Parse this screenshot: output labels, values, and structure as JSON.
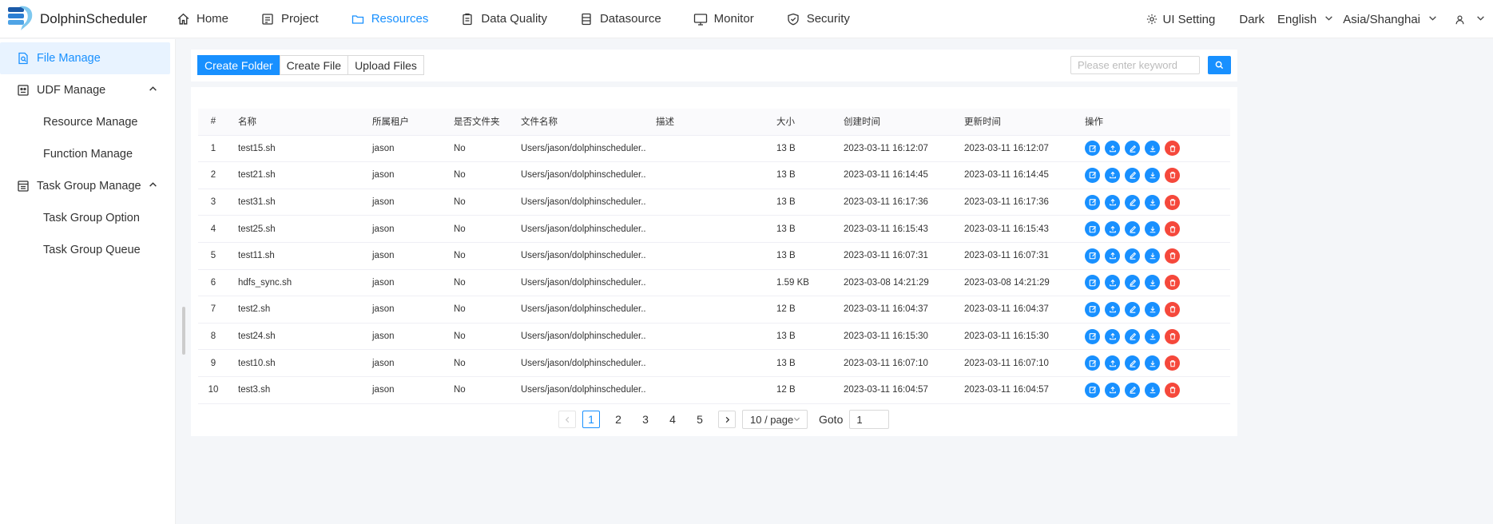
{
  "app": {
    "title": "DolphinScheduler"
  },
  "nav": [
    {
      "label": "Home",
      "icon": "home-icon"
    },
    {
      "label": "Project",
      "icon": "project-icon"
    },
    {
      "label": "Resources",
      "icon": "folder-icon",
      "active": true
    },
    {
      "label": "Data Quality",
      "icon": "clipboard-icon"
    },
    {
      "label": "Datasource",
      "icon": "datasource-icon"
    },
    {
      "label": "Monitor",
      "icon": "monitor-icon"
    },
    {
      "label": "Security",
      "icon": "shield-icon"
    }
  ],
  "header_right": {
    "ui_setting": "UI Setting",
    "theme": "Dark",
    "language": "English",
    "timezone": "Asia/Shanghai"
  },
  "sidebar": {
    "file_manage": "File Manage",
    "udf_manage": "UDF Manage",
    "resource_manage": "Resource Manage",
    "function_manage": "Function Manage",
    "task_group_manage": "Task Group Manage",
    "task_group_option": "Task Group Option",
    "task_group_queue": "Task Group Queue"
  },
  "toolbar": {
    "create_folder": "Create Folder",
    "create_file": "Create File",
    "upload_files": "Upload Files",
    "search_placeholder": "Please enter keyword"
  },
  "table": {
    "headers": [
      "#",
      "名称",
      "所属租户",
      "是否文件夹",
      "文件名称",
      "描述",
      "大小",
      "创建时间",
      "更新时间",
      "操作"
    ],
    "rows": [
      [
        "1",
        "test15.sh",
        "jason",
        "No",
        "Users/jason/dolphinscheduler...",
        "",
        "13 B",
        "2023-03-11 16:12:07",
        "2023-03-11 16:12:07"
      ],
      [
        "2",
        "test21.sh",
        "jason",
        "No",
        "Users/jason/dolphinscheduler...",
        "",
        "13 B",
        "2023-03-11 16:14:45",
        "2023-03-11 16:14:45"
      ],
      [
        "3",
        "test31.sh",
        "jason",
        "No",
        "Users/jason/dolphinscheduler...",
        "",
        "13 B",
        "2023-03-11 16:17:36",
        "2023-03-11 16:17:36"
      ],
      [
        "4",
        "test25.sh",
        "jason",
        "No",
        "Users/jason/dolphinscheduler...",
        "",
        "13 B",
        "2023-03-11 16:15:43",
        "2023-03-11 16:15:43"
      ],
      [
        "5",
        "test11.sh",
        "jason",
        "No",
        "Users/jason/dolphinscheduler...",
        "",
        "13 B",
        "2023-03-11 16:07:31",
        "2023-03-11 16:07:31"
      ],
      [
        "6",
        "hdfs_sync.sh",
        "jason",
        "No",
        "Users/jason/dolphinscheduler...",
        "",
        "1.59 KB",
        "2023-03-08 14:21:29",
        "2023-03-08 14:21:29"
      ],
      [
        "7",
        "test2.sh",
        "jason",
        "No",
        "Users/jason/dolphinscheduler...",
        "",
        "12 B",
        "2023-03-11 16:04:37",
        "2023-03-11 16:04:37"
      ],
      [
        "8",
        "test24.sh",
        "jason",
        "No",
        "Users/jason/dolphinscheduler...",
        "",
        "13 B",
        "2023-03-11 16:15:30",
        "2023-03-11 16:15:30"
      ],
      [
        "9",
        "test10.sh",
        "jason",
        "No",
        "Users/jason/dolphinscheduler...",
        "",
        "13 B",
        "2023-03-11 16:07:10",
        "2023-03-11 16:07:10"
      ],
      [
        "10",
        "test3.sh",
        "jason",
        "No",
        "Users/jason/dolphinscheduler...",
        "",
        "12 B",
        "2023-03-11 16:04:57",
        "2023-03-11 16:04:57"
      ]
    ],
    "actions": [
      "edit-icon",
      "reupload-icon",
      "rename-icon",
      "download-icon",
      "delete-icon"
    ]
  },
  "pagination": {
    "pages": [
      "1",
      "2",
      "3",
      "4",
      "5"
    ],
    "current": "1",
    "page_size": "10 / page",
    "goto_label": "Goto",
    "goto_value": "1"
  },
  "colors": {
    "accent": "#1890ff",
    "danger": "#f5483b"
  }
}
